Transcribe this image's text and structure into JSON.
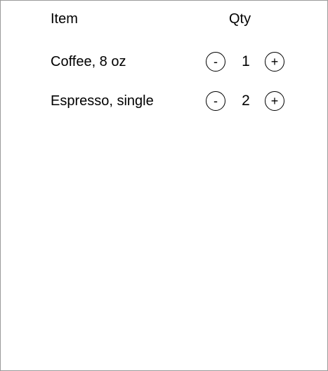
{
  "header": {
    "item_label": "Item",
    "qty_label": "Qty"
  },
  "rows": [
    {
      "item": "Coffee, 8 oz",
      "decrement_label": "-",
      "quantity": "1",
      "increment_label": "+"
    },
    {
      "item": "Espresso, single",
      "decrement_label": "-",
      "quantity": "2",
      "increment_label": "+"
    }
  ]
}
